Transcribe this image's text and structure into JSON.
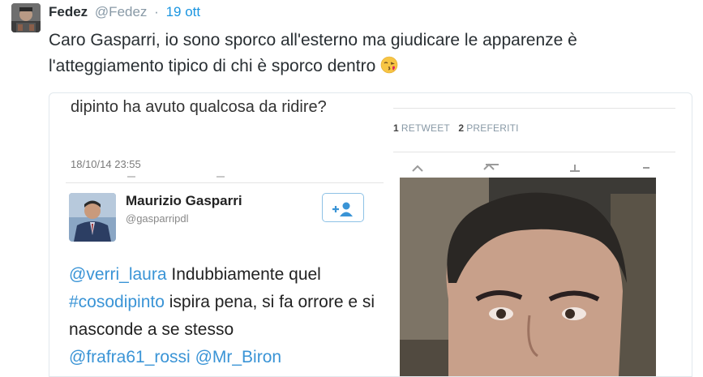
{
  "tweet": {
    "author_name": "Fedez",
    "author_handle": "@Fedez",
    "separator": "·",
    "date": "19 ott",
    "text": "Caro Gasparri, io sono sporco all'esterno ma giudicare le apparenze è l'atteggiamento tipico di chi è sporco dentro"
  },
  "media": {
    "previous_tweet": {
      "text": "dipinto ha avuto qualcosa da ridire?",
      "timestamp": "18/10/14 23:55"
    },
    "quoted": {
      "name": "Maurizio Gasparri",
      "handle": "@gasparripdl",
      "follow_label": "+👤",
      "mention1": "@verri_laura",
      "text1": " Indubbiamente quel",
      "hashtag": "#cosodipinto",
      "text2": " ispira pena, si fa orrore e si nasconde a se stesso",
      "mention2": "@frafra61_rossi",
      "mention3": "@Mr_Biron"
    },
    "stats": {
      "retweets_count": "1",
      "retweets_label": "RETWEET",
      "favorites_count": "2",
      "favorites_label": "PREFERITI"
    }
  },
  "colors": {
    "link": "#1b95e0",
    "text": "#292f33",
    "muted": "#8899a6"
  }
}
